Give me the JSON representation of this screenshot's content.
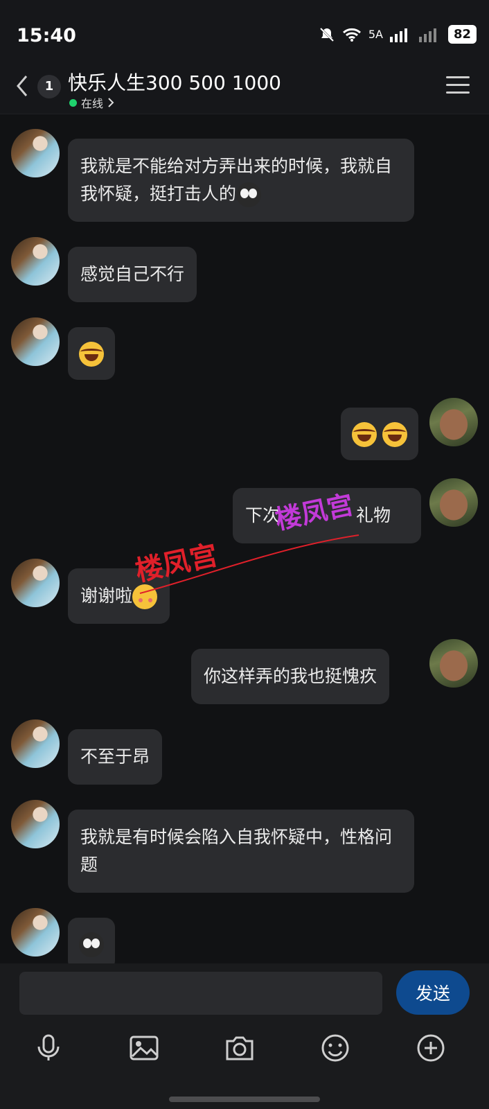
{
  "status_bar": {
    "time": "15:40",
    "network_label": "5A",
    "battery": "82"
  },
  "header": {
    "unread_count": "1",
    "title": "快乐人生300 500 1000",
    "status": "在线",
    "status_color": "#1fd26d"
  },
  "messages": [
    {
      "sender": "her",
      "text": "我就是不能给对方弄出来的时候，我就自我怀疑，挺打击人的",
      "emoji": "eyes-emoji"
    },
    {
      "sender": "her",
      "text": "感觉自己不行"
    },
    {
      "sender": "her",
      "text": "",
      "emoji": "laugh-cry-emoji"
    },
    {
      "sender": "me",
      "text": "",
      "emoji": "laugh-cry-emoji x2"
    },
    {
      "sender": "me",
      "text": "下次",
      "text_tail": "礼物"
    },
    {
      "sender": "her",
      "text": "谢谢啦",
      "emoji": "kiss-emoji"
    },
    {
      "sender": "me",
      "text": "你这样弄的我也挺愧疚"
    },
    {
      "sender": "her",
      "text": "不至于昂"
    },
    {
      "sender": "her",
      "text": "我就是有时候会陷入自我怀疑中，性格问题"
    },
    {
      "sender": "her",
      "text": "",
      "emoji": "eyes-emoji"
    }
  ],
  "watermarks": [
    "楼凤宫",
    "楼凤宫"
  ],
  "composer": {
    "placeholder": "",
    "send_label": "发送"
  },
  "colors": {
    "background": "#111214",
    "bubble": "#2b2c2f",
    "send_button": "#0e4a8f"
  }
}
